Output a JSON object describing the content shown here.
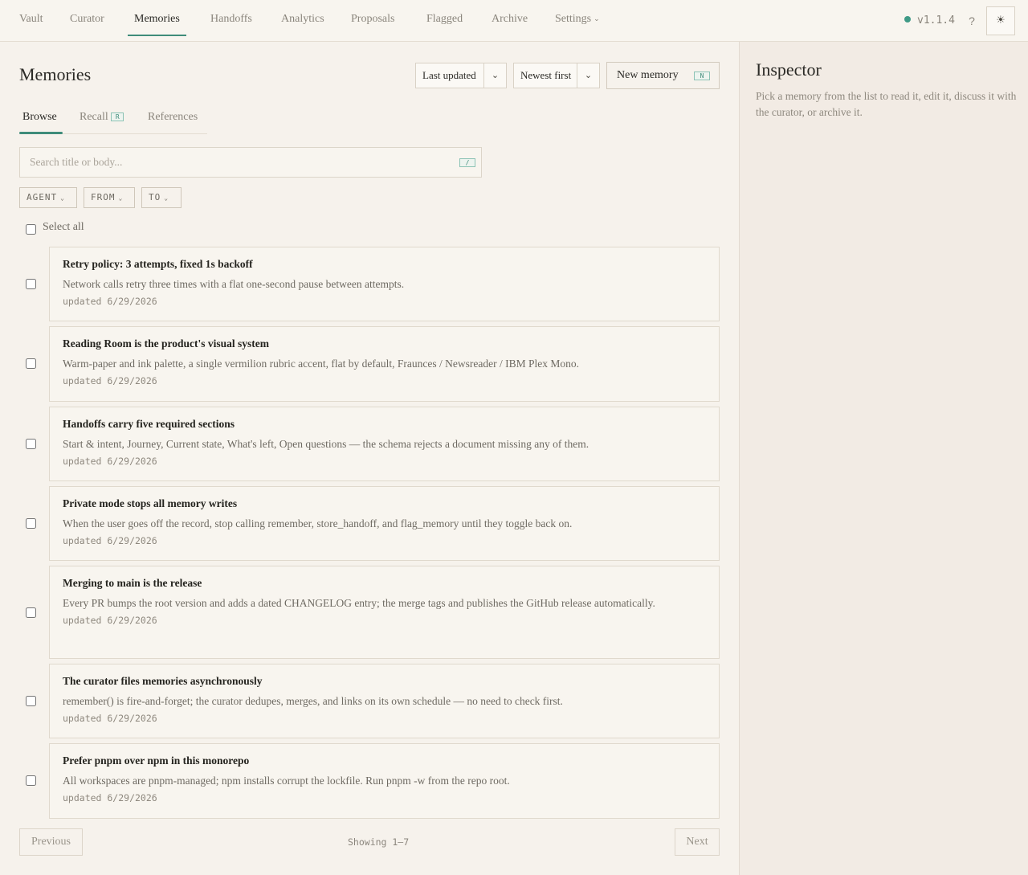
{
  "nav": {
    "items": [
      {
        "label": "Vault"
      },
      {
        "label": "Curator"
      },
      {
        "label": "Memories"
      },
      {
        "label": "Handoffs"
      },
      {
        "label": "Analytics"
      },
      {
        "label": "Proposals"
      },
      {
        "label": "Flagged"
      },
      {
        "label": "Archive"
      },
      {
        "label": "Settings"
      }
    ],
    "active": "Memories",
    "settings_caret": "⌄",
    "version": "v1.1.4",
    "status_color": "#3f9a86",
    "help_label": "?",
    "theme_icon": "☀"
  },
  "main": {
    "title": "Memories",
    "sort_field": "Last updated",
    "sort_order": "Newest first",
    "new_button": {
      "label": "New memory",
      "shortcut": "N"
    },
    "tabs": [
      {
        "label": "Browse"
      },
      {
        "label": "Recall",
        "shortcut": "R"
      },
      {
        "label": "References"
      }
    ],
    "active_tab": "Browse",
    "search": {
      "placeholder": "Search title or body...",
      "shortcut": "/"
    },
    "filters": [
      {
        "label": "AGENT"
      },
      {
        "label": "FROM"
      },
      {
        "label": "TO"
      }
    ],
    "select_all": "Select all",
    "memories": [
      {
        "title": "Retry policy: 3 attempts, fixed 1s backoff",
        "body": "Network calls retry three times with a flat one-second pause between attempts.",
        "meta": "updated 6/29/2026"
      },
      {
        "title": "Reading Room is the product's visual system",
        "body": "Warm-paper and ink palette, a single vermilion rubric accent, flat by default, Fraunces / Newsreader / IBM Plex Mono.",
        "meta": "updated 6/29/2026"
      },
      {
        "title": "Handoffs carry five required sections",
        "body": "Start & intent, Journey, Current state, What's left, Open questions — the schema rejects a document missing any of them.",
        "meta": "updated 6/29/2026"
      },
      {
        "title": "Private mode stops all memory writes",
        "body": "When the user goes off the record, stop calling remember, store_handoff, and flag_memory until they toggle back on.",
        "meta": "updated 6/29/2026"
      },
      {
        "title": "Merging to main is the release",
        "body": "Every PR bumps the root version and adds a dated CHANGELOG entry; the merge tags and publishes the GitHub release automatically.",
        "meta": "updated 6/29/2026"
      },
      {
        "title": "The curator files memories asynchronously",
        "body": "remember() is fire-and-forget; the curator dedupes, merges, and links on its own schedule — no need to check first.",
        "meta": "updated 6/29/2026"
      },
      {
        "title": "Prefer pnpm over npm in this monorepo",
        "body": "All workspaces are pnpm-managed; npm installs corrupt the lockfile. Run pnpm -w from the repo root.",
        "meta": "updated 6/29/2026"
      }
    ],
    "pager": {
      "previous": "Previous",
      "next": "Next",
      "showing": "Showing 1–7"
    }
  },
  "inspector": {
    "title": "Inspector",
    "hint": "Pick a memory from the list to read it, edit it, discuss it with the curator, or archive it."
  },
  "colors": {
    "accent": "#3f8c7a",
    "background": "#f6f2ec",
    "inspector_bg": "#f2ebe4"
  }
}
